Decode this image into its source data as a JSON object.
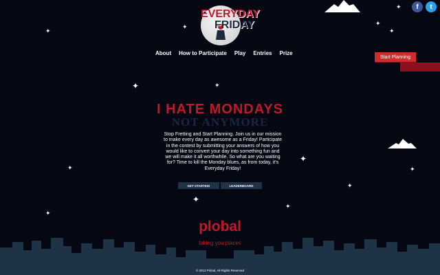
{
  "logo": {
    "line1": "EVERYDAY",
    "line2": "FRIDAY"
  },
  "social": {
    "facebook": "f",
    "twitter": "t"
  },
  "nav": [
    {
      "label": "About"
    },
    {
      "label": "How to Participate"
    },
    {
      "label": "Play"
    },
    {
      "label": "Entries"
    },
    {
      "label": "Prize"
    }
  ],
  "cta": {
    "start_planning": "Start Planning"
  },
  "hero": {
    "headline": "I HATE MONDAYS",
    "subheadline": "NOT ANYMORE",
    "description": "Stop Fretting and Start Planning. Join us in our mission to make every day as awesome as a Friday! Participate in the contest by submitting your answers of how you would like to convert your day into something fun and we will make it all worthwhile. So what are you waiting for? Time to kill the Monday blues, as from today, it's Everyday Friday!"
  },
  "buttons": {
    "get_started": "GET STARTED!",
    "leaderboard": "LEADERBOARD"
  },
  "brand": {
    "name": "plobal",
    "tagline": "taking you places"
  },
  "footer": {
    "copyright": "© 2013 Plobal, All Rights Reserved"
  },
  "colors": {
    "accent": "#c3172b",
    "background": "#050713",
    "button": "#1e3346",
    "skyline": "#1e3346"
  }
}
